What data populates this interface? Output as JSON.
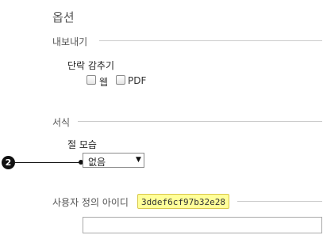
{
  "page": {
    "title": "옵션"
  },
  "export": {
    "section_label": "내보내기",
    "hide_paragraph_label": "단락 감추기",
    "options": [
      {
        "label": "웹",
        "checked": false
      },
      {
        "label": "PDF",
        "checked": false
      }
    ]
  },
  "format": {
    "section_label": "서식",
    "paragraph_style_label": "절 모습",
    "paragraph_style_value": "없음",
    "callout_number": "2"
  },
  "custom_id": {
    "label": "사용자 정의 아이디",
    "value": "3ddef6cf97b32e28",
    "input_value": ""
  },
  "icons": {
    "dropdown": "chevron-down-icon"
  }
}
